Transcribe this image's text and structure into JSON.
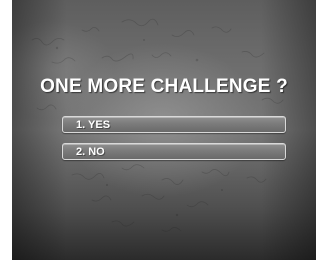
{
  "prompt": {
    "title": "ONE MORE CHALLENGE ?"
  },
  "options": [
    {
      "label": "1. YES"
    },
    {
      "label": "2. NO"
    }
  ]
}
